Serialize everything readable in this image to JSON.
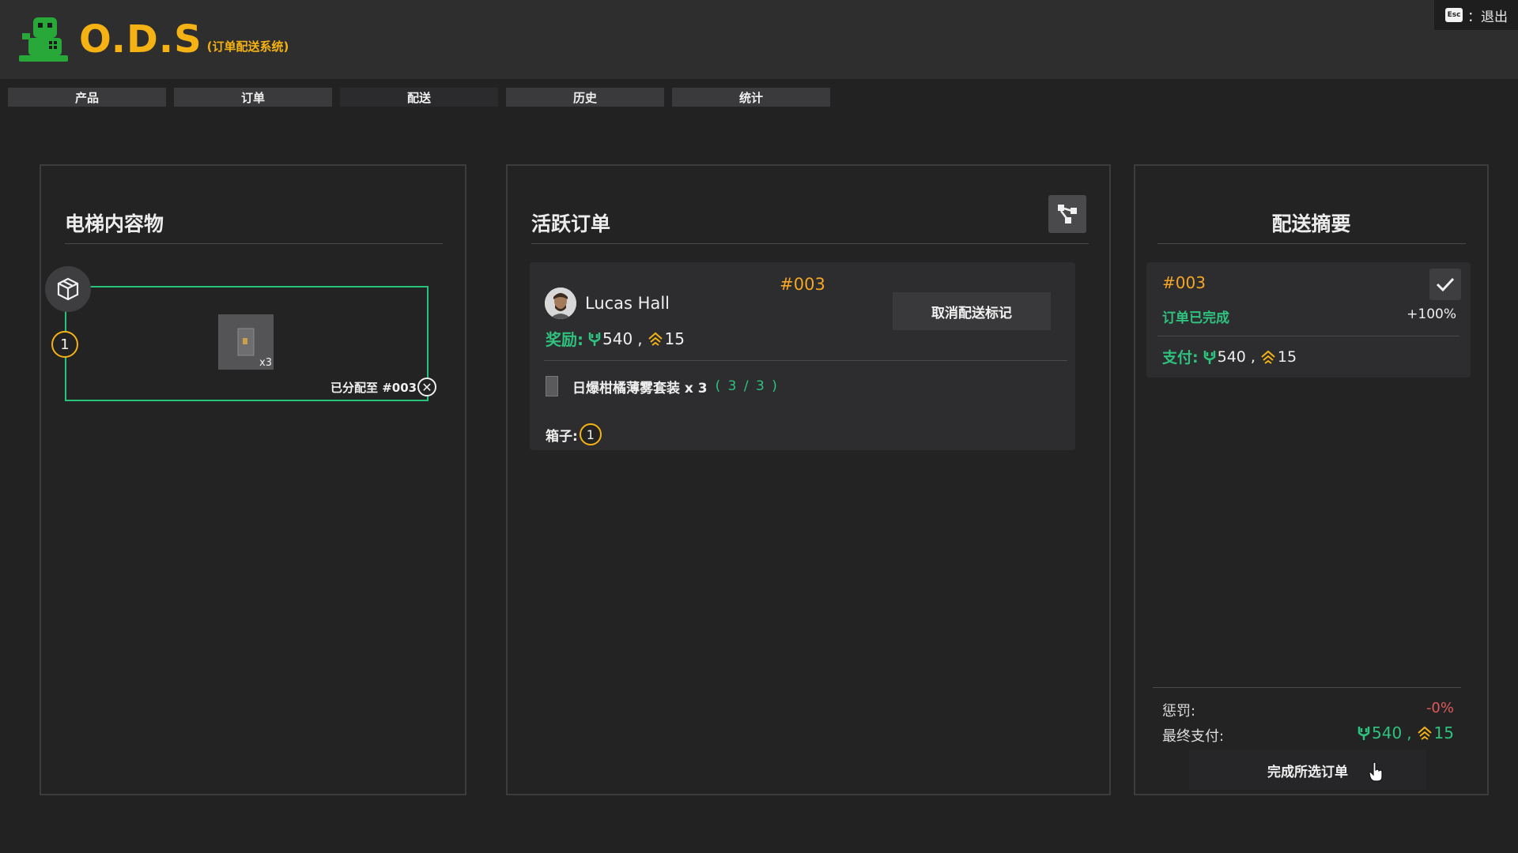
{
  "app": {
    "logo_title": "O.D.S",
    "logo_subtitle": "(订单配送系统)",
    "esc_key": "Esc",
    "exit_label": "：退出"
  },
  "tabs": [
    {
      "label": "产品"
    },
    {
      "label": "订单"
    },
    {
      "label": "配送"
    },
    {
      "label": "历史"
    },
    {
      "label": "统计"
    }
  ],
  "elevator": {
    "title": "电梯内容物",
    "box_number": "1",
    "item_qty": "x3",
    "assigned_label": "已分配至 #003"
  },
  "active_orders": {
    "title": "活跃订单",
    "order": {
      "id": "#003",
      "customer": "Lucas Hall",
      "reward_label": "奖励:",
      "reward_money": "540",
      "reward_sep": ",",
      "reward_xp": "15",
      "cancel_label": "取消配送标记",
      "product_name": "日爆柑橘薄雾套装 x 3",
      "product_count": "( 3 / 3 )",
      "boxes_label": "箱子:",
      "box_number": "1"
    }
  },
  "summary": {
    "title": "配送摘要",
    "order_id": "#003",
    "status": "订单已完成",
    "percent": "+100%",
    "pay_label": "支付:",
    "pay_money": "540",
    "pay_sep": ",",
    "pay_xp": "15",
    "penalty_label": "惩罚:",
    "penalty_value": "-0%",
    "final_label": "最终支付:",
    "final_money": "540",
    "final_sep": ",",
    "final_xp": "15",
    "complete_label": "完成所选订单"
  },
  "colors": {
    "accent_gold": "#f5b214",
    "order_orange": "#f5a623",
    "green": "#2ec27e",
    "penalty_red": "#e05a5a"
  },
  "icons": {
    "logo": "robot-logo-icon",
    "box": "box-icon",
    "route": "route-share-icon",
    "check": "check-icon",
    "close": "close-circle-icon",
    "money": "money-icon",
    "xp": "xp-chevron-icon",
    "cursor": "hand-cursor-icon"
  }
}
